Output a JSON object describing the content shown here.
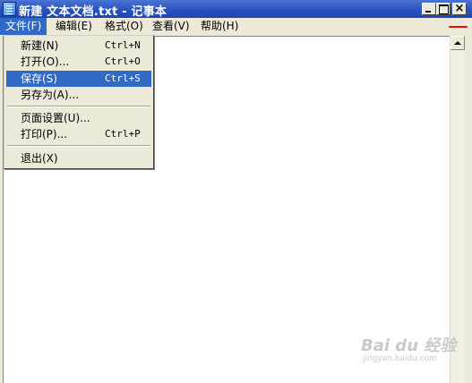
{
  "window": {
    "title": "新建 文本文档.txt - 记事本"
  },
  "menubar": {
    "file": "文件(F)",
    "edit": "编辑(E)",
    "format": "格式(O)",
    "view": "查看(V)",
    "help": "帮助(H)"
  },
  "file_menu": {
    "items": [
      {
        "label": "新建(N)",
        "shortcut": "Ctrl+N"
      },
      {
        "label": "打开(O)...",
        "shortcut": "Ctrl+O"
      },
      {
        "label": "保存(S)",
        "shortcut": "Ctrl+S",
        "selected": true
      },
      {
        "label": "另存为(A)...",
        "shortcut": ""
      },
      {
        "label": "页面设置(U)...",
        "shortcut": ""
      },
      {
        "label": "打印(P)...",
        "shortcut": "Ctrl+P"
      },
      {
        "label": "退出(X)",
        "shortcut": ""
      }
    ]
  },
  "watermark": {
    "text": "Bai du 经验",
    "subtext": "jingyan.baidu.com"
  },
  "colors": {
    "titlebar": "#2a52be",
    "selection": "#316ac5",
    "annotation": "#e01010"
  },
  "icons": {
    "app": "notepad-icon",
    "minimize": "minimize-icon",
    "maximize": "maximize-icon",
    "close": "close-icon"
  }
}
